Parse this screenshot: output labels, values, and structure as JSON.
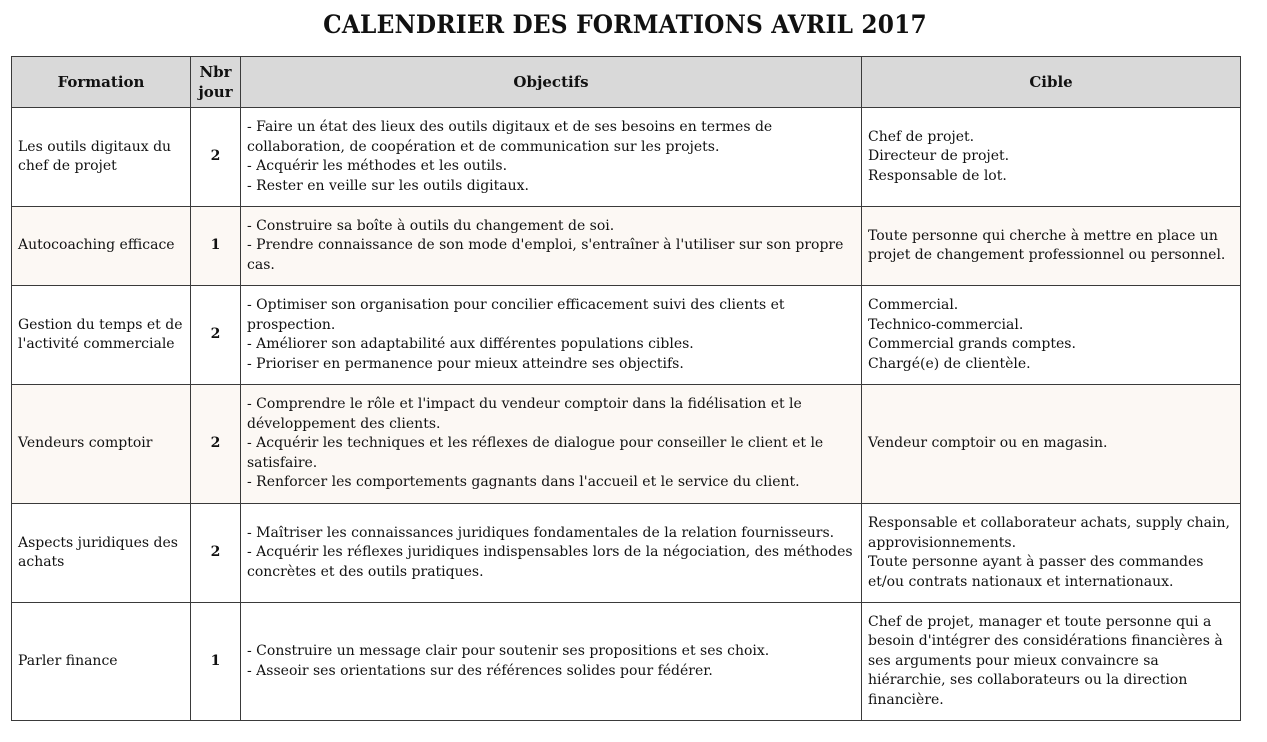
{
  "title": "CALENDRIER DES FORMATIONS AVRIL 2017",
  "headers": {
    "formation": "Formation",
    "nbr_jour": "Nbr jour",
    "objectifs": "Objectifs",
    "cible": "Cible"
  },
  "rows": [
    {
      "formation": " Les outils digitaux du chef de projet",
      "jours": "2",
      "objectifs": [
        " - Faire un état des lieux des outils digitaux et de ses besoins en termes de collaboration, de coopération et de communication sur les projets.",
        " - Acquérir les méthodes et les outils.",
        " - Rester en veille sur les outils digitaux."
      ],
      "cible": [
        "Chef de projet.",
        "Directeur de projet.",
        "Responsable de lot."
      ]
    },
    {
      "formation": "Autocoaching efficace",
      "jours": "1",
      "objectifs": [
        " - Construire sa boîte à outils du changement de soi.",
        " - Prendre connaissance de son mode d'emploi, s'entraîner à l'utiliser sur son propre cas."
      ],
      "cible": [
        "Toute personne qui cherche à mettre en place un projet de changement professionnel ou personnel."
      ]
    },
    {
      "formation": "Gestion du temps et de l'activité commerciale",
      "jours": "2",
      "objectifs": [
        " - Optimiser son organisation pour concilier efficacement suivi des clients et prospection.",
        " - Améliorer son adaptabilité aux différentes populations cibles.",
        " - Prioriser en permanence pour mieux atteindre ses objectifs."
      ],
      "cible": [
        "Commercial.",
        "Technico-commercial.",
        "Commercial grands comptes.",
        "Chargé(e) de clientèle."
      ]
    },
    {
      "formation": "Vendeurs comptoir",
      "jours": "2",
      "objectifs": [
        " - Comprendre le rôle et l'impact du vendeur comptoir dans la fidélisation et le développement des clients.",
        " - Acquérir les techniques et les réflexes de dialogue pour conseiller le client et le satisfaire.",
        " - Renforcer les comportements gagnants dans l'accueil et le service du client."
      ],
      "cible": [
        "Vendeur comptoir ou en magasin."
      ]
    },
    {
      "formation": "Aspects juridiques des achats",
      "jours": "2",
      "objectifs": [
        " - Maîtriser les connaissances juridiques fondamentales de la relation fournisseurs.",
        " - Acquérir les réflexes juridiques indispensables lors de la négociation, des méthodes concrètes et des outils pratiques."
      ],
      "cible": [
        "Responsable et collaborateur achats, supply chain, approvisionnements.",
        "Toute personne ayant à passer des commandes et/ou contrats nationaux et internationaux."
      ]
    },
    {
      "formation": "Parler finance",
      "jours": "1",
      "objectifs": [
        " - Construire un message clair pour soutenir ses propositions et ses choix.",
        " - Asseoir ses orientations sur des références solides pour fédérer."
      ],
      "cible": [
        "Chef de projet, manager et toute personne qui a besoin d'intégrer des considérations financières à ses arguments pour mieux convaincre sa hiérarchie, ses collaborateurs ou la direction financière."
      ]
    }
  ],
  "colors": {
    "header_bg": "#d9d9d9",
    "tinted_row_bg": "#fcf8f4",
    "border": "#3a3a3a"
  }
}
